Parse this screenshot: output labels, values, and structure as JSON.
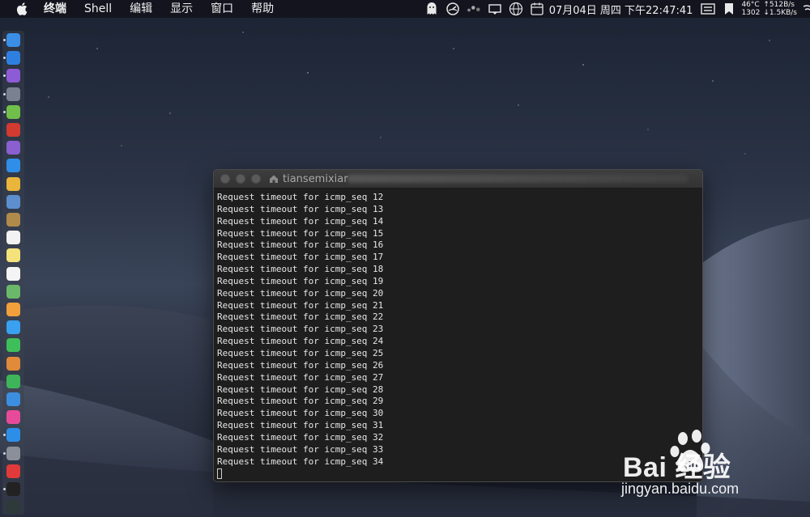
{
  "menubar": {
    "app_name": "终端",
    "items": [
      "Shell",
      "编辑",
      "显示",
      "窗口",
      "帮助"
    ],
    "clock": "07月04日 周四 下午22:47:41",
    "temp": "46°C",
    "fan": "1302",
    "upload": "↑512B/s",
    "download": "↓1.5KB/s"
  },
  "terminal": {
    "title": "tiansemixiar",
    "lines": [
      "Request timeout for icmp_seq 12",
      "Request timeout for icmp_seq 13",
      "Request timeout for icmp_seq 14",
      "Request timeout for icmp_seq 15",
      "Request timeout for icmp_seq 16",
      "Request timeout for icmp_seq 17",
      "Request timeout for icmp_seq 18",
      "Request timeout for icmp_seq 19",
      "Request timeout for icmp_seq 20",
      "Request timeout for icmp_seq 21",
      "Request timeout for icmp_seq 22",
      "Request timeout for icmp_seq 23",
      "Request timeout for icmp_seq 24",
      "Request timeout for icmp_seq 25",
      "Request timeout for icmp_seq 26",
      "Request timeout for icmp_seq 27",
      "Request timeout for icmp_seq 28",
      "Request timeout for icmp_seq 29",
      "Request timeout for icmp_seq 30",
      "Request timeout for icmp_seq 31",
      "Request timeout for icmp_seq 32",
      "Request timeout for icmp_seq 33",
      "Request timeout for icmp_seq 34"
    ]
  },
  "dock": {
    "icons": [
      {
        "name": "finder-icon",
        "color": "#3a8ee6"
      },
      {
        "name": "safari-icon",
        "color": "#2f7fe0"
      },
      {
        "name": "siri-icon",
        "color": "#8e5bd6"
      },
      {
        "name": "launchpad-icon",
        "color": "#7a8190"
      },
      {
        "name": "android-icon",
        "color": "#6fbf4a"
      },
      {
        "name": "app-red-icon",
        "color": "#d23b30"
      },
      {
        "name": "app-purple-icon",
        "color": "#8a5fd0"
      },
      {
        "name": "safari-compass-icon",
        "color": "#2f8fe8"
      },
      {
        "name": "chrome-icon",
        "color": "#e9b53b"
      },
      {
        "name": "preview-icon",
        "color": "#5d8fcf"
      },
      {
        "name": "notes-brown-icon",
        "color": "#b08a4a"
      },
      {
        "name": "calendar-icon",
        "color": "#f2f2f2"
      },
      {
        "name": "notes-icon",
        "color": "#f4e27a"
      },
      {
        "name": "reminders-icon",
        "color": "#f4f4f4"
      },
      {
        "name": "maps-icon",
        "color": "#6cb86a"
      },
      {
        "name": "photos-icon",
        "color": "#f2a03b"
      },
      {
        "name": "messages-icon",
        "color": "#3aa0f0"
      },
      {
        "name": "facetime-icon",
        "color": "#3fbf5a"
      },
      {
        "name": "pages-icon",
        "color": "#e08a3a"
      },
      {
        "name": "numbers-icon",
        "color": "#3fb55a"
      },
      {
        "name": "keynote-icon",
        "color": "#3c8ee0"
      },
      {
        "name": "itunes-icon",
        "color": "#e84a9a"
      },
      {
        "name": "app-store-icon",
        "color": "#2d8ee8"
      },
      {
        "name": "system-preferences-icon",
        "color": "#8a8f99"
      },
      {
        "name": "vivaldi-icon",
        "color": "#e03a3a"
      },
      {
        "name": "terminal-icon",
        "color": "#222222"
      },
      {
        "name": "activity-monitor-icon",
        "color": "#2e3a3a"
      }
    ]
  },
  "watermark": {
    "brand": "Bai  经验",
    "url": "jingyan.baidu.com"
  }
}
